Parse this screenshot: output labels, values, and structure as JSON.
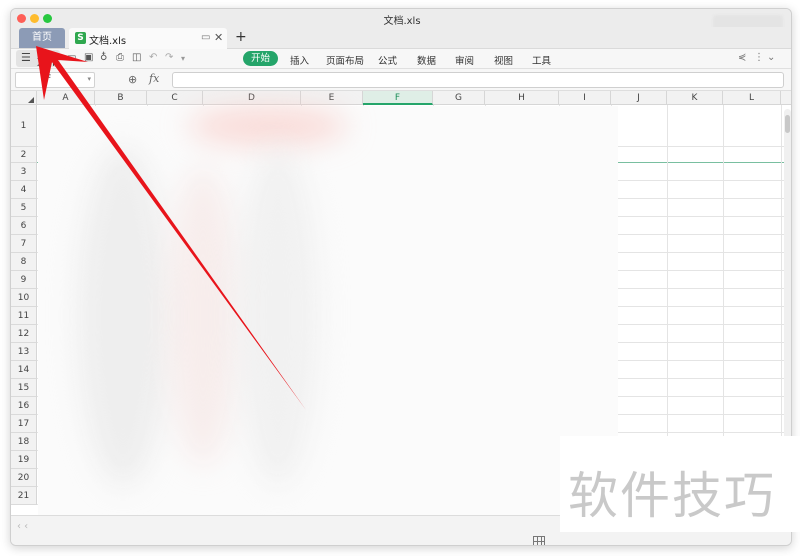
{
  "window": {
    "title": "文档.xls"
  },
  "tabs": [
    {
      "label": "首页"
    },
    {
      "label": "文档.xls"
    }
  ],
  "ribbon": {
    "file_label": "文件",
    "tabs": [
      "开始",
      "插入",
      "页面布局",
      "公式",
      "数据",
      "审阅",
      "视图",
      "工具"
    ],
    "active_tab": "开始"
  },
  "formula_bar": {
    "name_box": "F",
    "fx": "fx"
  },
  "columns": [
    "A",
    "B",
    "C",
    "D",
    "E",
    "F",
    "G",
    "H",
    "I",
    "J",
    "K",
    "L"
  ],
  "selected_column": "F",
  "rows": [
    "1",
    "2",
    "3",
    "4",
    "5",
    "6",
    "7",
    "8",
    "9",
    "10",
    "11",
    "12",
    "13",
    "14",
    "15",
    "16",
    "17",
    "18",
    "19",
    "20",
    "21"
  ],
  "watermark": "软件技巧",
  "colors": {
    "accent": "#25a56a",
    "arrow": "#e8141b",
    "home_tab": "#8c9bb6"
  }
}
